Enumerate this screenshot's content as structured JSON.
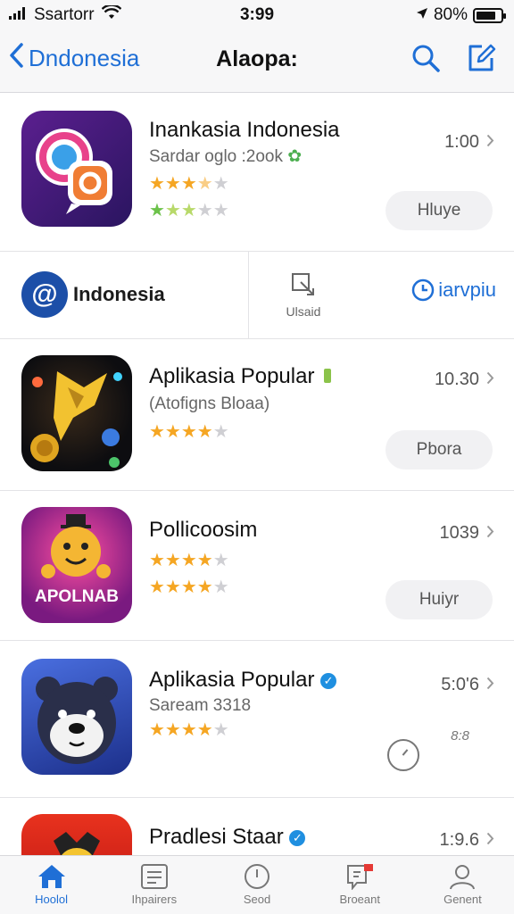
{
  "status_bar": {
    "carrier": "Ssartorr",
    "time": "3:99",
    "battery": "80%",
    "battery_level": 0.8
  },
  "nav": {
    "back_label": "Dndonesia",
    "title": "Alaopa:"
  },
  "apps": [
    {
      "name": "Inankasia Indonesia",
      "subtitle": "Sardar oglo :2ook",
      "time": "1:00",
      "button": "Hluye"
    },
    {
      "name": "Aplikasia Popular",
      "subtitle": "(Atofigns Bloaa)",
      "time": "10.30",
      "button": "Pbora"
    },
    {
      "name": "Pollicoosim",
      "subtitle": "",
      "time": "1039",
      "button": "Huiyr"
    },
    {
      "name": "Aplikasia Popular",
      "subtitle": "Saream 3318",
      "time": "5:0'6",
      "tag": "8:8"
    },
    {
      "name": "Pradlesi Staar",
      "subtitle": "",
      "time": "1:9.6"
    }
  ],
  "feature": {
    "brand": "Indonesia",
    "mid_label": "Ulsaid",
    "right_label": "iarvpiu"
  },
  "icon_art": {
    "app3_label": "APOLNAB"
  },
  "tabs": [
    {
      "label": "Hoolol",
      "icon": "home-icon"
    },
    {
      "label": "Ihpairers",
      "icon": "list-icon"
    },
    {
      "label": "Seod",
      "icon": "clock-icon"
    },
    {
      "label": "Broeant",
      "icon": "flag-icon"
    },
    {
      "label": "Genent",
      "icon": "person-icon"
    }
  ],
  "colors": {
    "accent": "#1f6fd6",
    "star": "#f5a623"
  }
}
